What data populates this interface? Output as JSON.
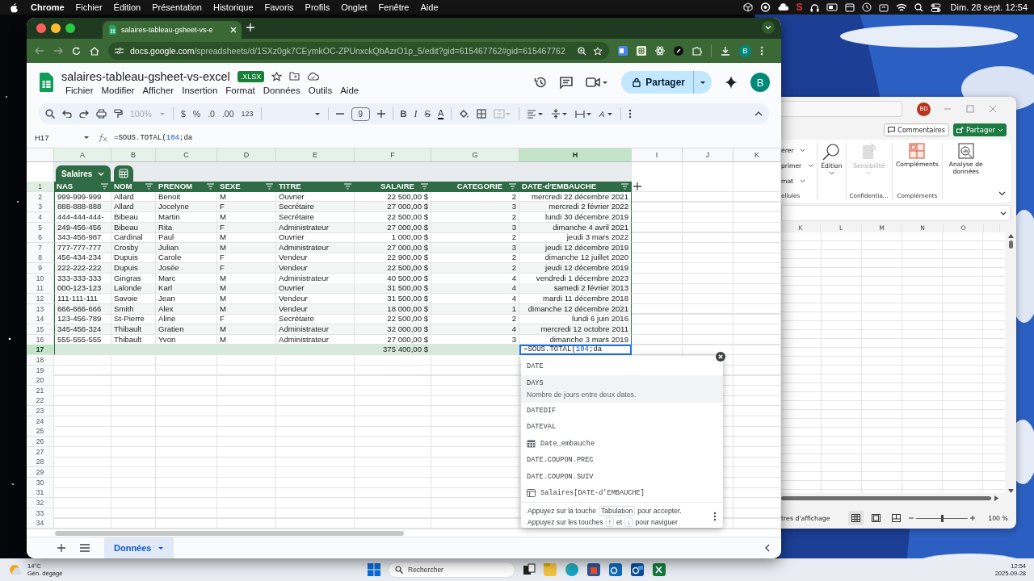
{
  "menubar": {
    "app": "Chrome",
    "menus": [
      "Fichier",
      "Édition",
      "Présentation",
      "Historique",
      "Favoris",
      "Profils",
      "Onglet",
      "Fenêtre",
      "Aide"
    ],
    "status_letter": "S",
    "clock": "Dim. 28 sept. 12:54"
  },
  "browser": {
    "tabs": [
      {
        "title": "salaires-tableau-gsheet-vs-e",
        "selected": true
      }
    ],
    "url_host": "docs.google.com",
    "url_path": "/spreadsheets/d/1SXz0gk7CEymkOC-ZPUnxckQbAzrO1p_5/edit?gid=615467762#gid=615467762",
    "profile": "B"
  },
  "sheets": {
    "title": "salaires-tableau-gsheet-vs-excel",
    "badge": ".XLSX",
    "menus": [
      "Fichier",
      "Modifier",
      "Afficher",
      "Insertion",
      "Format",
      "Données",
      "Outils",
      "Aide"
    ],
    "share": "Partager",
    "avatar": "B",
    "toolbar": {
      "zoom": {
        "label": "100%",
        "disabled": true
      },
      "currency": "$",
      "percent": "%",
      "decimals_less": ".0",
      "decimals_more": ".00",
      "number_format": "123",
      "font_size": "9",
      "bold": "B",
      "italic": "I",
      "strike": "S",
      "text_color": "A",
      "merge": {
        "disabled": true
      },
      "rotate": "A"
    },
    "name_box": "H17",
    "formula": {
      "head": "=SOUS.TOTAL(",
      "number": "104",
      "tail": ";da"
    },
    "columns": [
      {
        "letter": "A",
        "selected": false
      },
      {
        "letter": "B",
        "selected": false
      },
      {
        "letter": "C",
        "selected": false
      },
      {
        "letter": "D",
        "selected": false
      },
      {
        "letter": "E",
        "selected": false
      },
      {
        "letter": "F",
        "selected": false
      },
      {
        "letter": "G",
        "selected": false
      },
      {
        "letter": "H",
        "selected": true
      },
      {
        "letter": "I",
        "selected": false
      },
      {
        "letter": "J",
        "selected": false
      },
      {
        "letter": "K",
        "selected": false
      }
    ],
    "table": {
      "name": "Salaires",
      "header_row": "1",
      "headers": [
        "NAS",
        "NOM",
        "PRENOM",
        "SEXE",
        "TITRE",
        "SALAIRE",
        "CATEGORIE",
        "DATE-d'EMBAUCHE"
      ],
      "rows": [
        {
          "number": "2",
          "cells": [
            "999-999-999",
            "Allard",
            "Benoit",
            "M",
            "Ouvrier",
            "22 500,00 $",
            "2",
            "mercredi 22 décembre 2021"
          ]
        },
        {
          "number": "3",
          "cells": [
            "888-888-888",
            "Allard",
            "Jocelyne",
            "F",
            "Secrétaire",
            "27 000,00 $",
            "3",
            "mercredi 2 février 2022"
          ]
        },
        {
          "number": "4",
          "cells": [
            "444-444-444-",
            "Bibeau",
            "Martin",
            "M",
            "Secrétaire",
            "22 500,00 $",
            "2",
            "lundi 30 décembre 2019"
          ]
        },
        {
          "number": "5",
          "cells": [
            "249-456-456",
            "Bibeau",
            "Rita",
            "F",
            "Administrateur",
            "27 000,00 $",
            "3",
            "dimanche 4 avril 2021"
          ]
        },
        {
          "number": "6",
          "cells": [
            "343-456-987",
            "Cardinal",
            "Paul",
            "M",
            "Ouvrier",
            "1 000,00 $",
            "2",
            "jeudi 3 mars 2022"
          ]
        },
        {
          "number": "7",
          "cells": [
            "777-777-777",
            "Crosby",
            "Julian",
            "M",
            "Administrateur",
            "27 000,00 $",
            "3",
            "jeudi 12 décembre 2019"
          ]
        },
        {
          "number": "8",
          "cells": [
            "456-434-234",
            "Dupuis",
            "Carole",
            "F",
            "Vendeur",
            "22 900,00 $",
            "2",
            "dimanche 12 juillet 2020"
          ]
        },
        {
          "number": "9",
          "cells": [
            "222-222-222",
            "Dupuis",
            "Josée",
            "F",
            "Vendeur",
            "22 500,00 $",
            "2",
            "jeudi 12 décembre 2019"
          ]
        },
        {
          "number": "10",
          "cells": [
            "333-333-333",
            "Gingras",
            "Marc",
            "M",
            "Administrateur",
            "40 500,00 $",
            "4",
            "vendredi 1 décembre 2023"
          ]
        },
        {
          "number": "11",
          "cells": [
            "000-123-123",
            "Lalonde",
            "Karl",
            "M",
            "Ouvrier",
            "31 500,00 $",
            "4",
            "samedi 2 février 2013"
          ]
        },
        {
          "number": "12",
          "cells": [
            "111-111-111",
            "Savoie",
            "Jean",
            "M",
            "Vendeur",
            "31 500,00 $",
            "4",
            "mardi 11 décembre 2018"
          ]
        },
        {
          "number": "13",
          "cells": [
            "666-666-666",
            "Smith",
            "Alex",
            "M",
            "Vendeur",
            "18 000,00 $",
            "1",
            "dimanche 12 décembre 2021"
          ]
        },
        {
          "number": "14",
          "cells": [
            "123-456-789",
            "St-Pierre",
            "Aline",
            "F",
            "Secrétaire",
            "22 500,00 $",
            "2",
            "lundi 6 juin 2016"
          ]
        },
        {
          "number": "15",
          "cells": [
            "345-456-324",
            "Thibault",
            "Gratien",
            "M",
            "Administrateur",
            "32 000,00 $",
            "4",
            "mercredi 12 octobre 2011"
          ]
        },
        {
          "number": "16",
          "cells": [
            "555-555-555",
            "Thibault",
            "Yvon",
            "M",
            "Administrateur",
            "27 000,00 $",
            "3",
            "dimanche 3 mars 2019"
          ]
        }
      ],
      "total": {
        "number": "17",
        "selected": true,
        "salary": "375 400,00 $",
        "editor": {
          "head": "=SOUS.TOTAL(",
          "number": "104",
          "tail": ";da"
        }
      }
    },
    "empty_rows": [
      "18",
      "19",
      "20",
      "21",
      "22",
      "23",
      "24",
      "25",
      "26",
      "27",
      "28",
      "29",
      "30",
      "31",
      "32",
      "33",
      "34"
    ],
    "autocomplete": {
      "items": [
        {
          "kind": "function",
          "label": "DATE",
          "selected": false
        },
        {
          "kind": "function",
          "label": "DAYS",
          "selected": true,
          "description": "Nombre de jours entre deux dates."
        },
        {
          "kind": "function",
          "label": "DATEDIF",
          "selected": false
        },
        {
          "kind": "function",
          "label": "DATEVAL",
          "selected": false
        },
        {
          "kind": "named_range",
          "label": "Date_embauche",
          "selected": false
        },
        {
          "kind": "function",
          "label": "DATE.COUPON.PREC",
          "selected": false
        },
        {
          "kind": "function",
          "label": "DATE.COUPON.SUIV",
          "selected": false
        },
        {
          "kind": "table_ref",
          "label": "Salaires[DATE-d'EMBAUCHE]",
          "selected": false
        }
      ],
      "hint": [
        [
          {
            "kind": "text",
            "text": "Appuyez sur la touche"
          },
          {
            "kind": "key",
            "text": "Tabulation"
          },
          {
            "kind": "text",
            "text": "pour accepter."
          }
        ],
        [
          {
            "kind": "text",
            "text": "Appuyez sur les touches"
          },
          {
            "kind": "key",
            "text": "↑"
          },
          {
            "kind": "text",
            "text": "et"
          },
          {
            "kind": "key",
            "text": "↓"
          },
          {
            "kind": "text",
            "text": "pour naviguer"
          }
        ]
      ]
    },
    "sheet_tabs": [
      {
        "label": "Données",
        "selected": true
      }
    ]
  },
  "excel": {
    "avatar": "BD",
    "comments": "Commentaires",
    "share": "Partager",
    "ribbon_cut": [
      "érer",
      "primer",
      "mat"
    ],
    "group_cut": "ellules",
    "edit": "Édition",
    "sensitivity": {
      "label": "Sensibilité",
      "disabled": true
    },
    "group_confidential": "Confidentia…",
    "addins": "Compléments",
    "group_addins": "Compléments",
    "analyze": "Analyse de données",
    "columns": [
      "K",
      "L",
      "M",
      "N",
      "O"
    ],
    "status": "tres d'affichage",
    "zoom_slider": {
      "level": 0.5
    },
    "zoom": "100 %"
  },
  "taskbar": {
    "temperature": "14°C",
    "weather": "Gén. dégagé",
    "search": "Rechercher",
    "time": "12:54",
    "date": "2025-09-28"
  }
}
